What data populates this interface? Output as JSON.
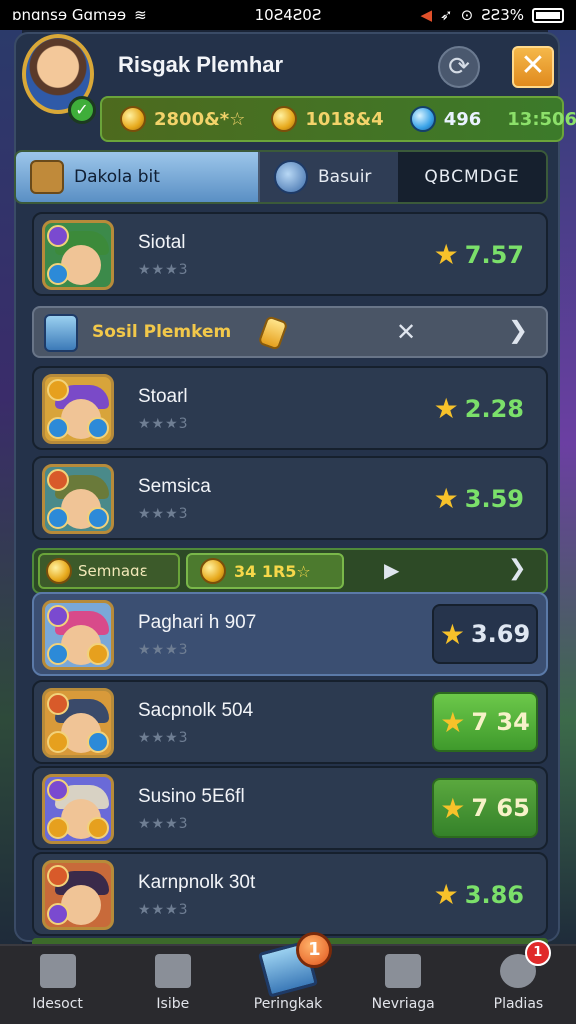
{
  "status_bar": {
    "carrier": "ɒnɑnsɘ Gɑmɘɘ",
    "time": "10Ƨ4Ƨ0Ƨ",
    "battery": "ƧƧ3%"
  },
  "header": {
    "player_name": "Risgak Plemhar",
    "currency": [
      {
        "icon": "gold-coin-icon",
        "value": "2800&*☆"
      },
      {
        "icon": "gold-coin-icon",
        "value": "1018&4"
      },
      {
        "icon": "blue-gem-icon",
        "value": "496"
      },
      {
        "icon": "timer-value",
        "value": "13:506"
      }
    ]
  },
  "tabs": [
    {
      "label": "Dakola bit",
      "icon": "treasure-chest-icon"
    },
    {
      "label": "Basuir",
      "icon": "compass-icon"
    },
    {
      "label": "QBCMDGE",
      "icon": ""
    }
  ],
  "rows": [
    {
      "name": "Siotal",
      "rating": "★★★3",
      "score": "7.57"
    },
    {
      "name": "Stoarl",
      "rating": "★★★3",
      "score": "2.28"
    },
    {
      "name": "Semsica",
      "rating": "★★★3",
      "score": "3.59"
    },
    {
      "name": "Paghari h 907",
      "rating": "★★★3",
      "score": "3.69"
    },
    {
      "name": "Sacpnolk 504",
      "rating": "★★★3",
      "score": "7 34"
    },
    {
      "name": "Susino 5E6fl",
      "rating": "★★★3",
      "score": "7 65"
    },
    {
      "name": "Karnpnolk 30t",
      "rating": "★★★3",
      "score": "3.86"
    }
  ],
  "social_bar": {
    "label": "Sosil Plemkem"
  },
  "season_bar": {
    "left_label": "Semnaɑɛ",
    "right_label": "34  1R5☆"
  },
  "bottom_nav": [
    {
      "label": "Idesoct",
      "icon": "home-icon"
    },
    {
      "label": "Isibe",
      "icon": "shop-icon"
    },
    {
      "label": "Peringkak",
      "icon": "rankings-icon",
      "badge": "1"
    },
    {
      "label": "Nevriaga",
      "icon": "edit-icon"
    },
    {
      "label": "Pladias",
      "icon": "settings-icon",
      "badge": "1"
    }
  ],
  "colors": {
    "panel": "#24324a",
    "score_green": "#7be06a",
    "star": "#f7c22a",
    "accent_orange": "#e08a1e"
  }
}
